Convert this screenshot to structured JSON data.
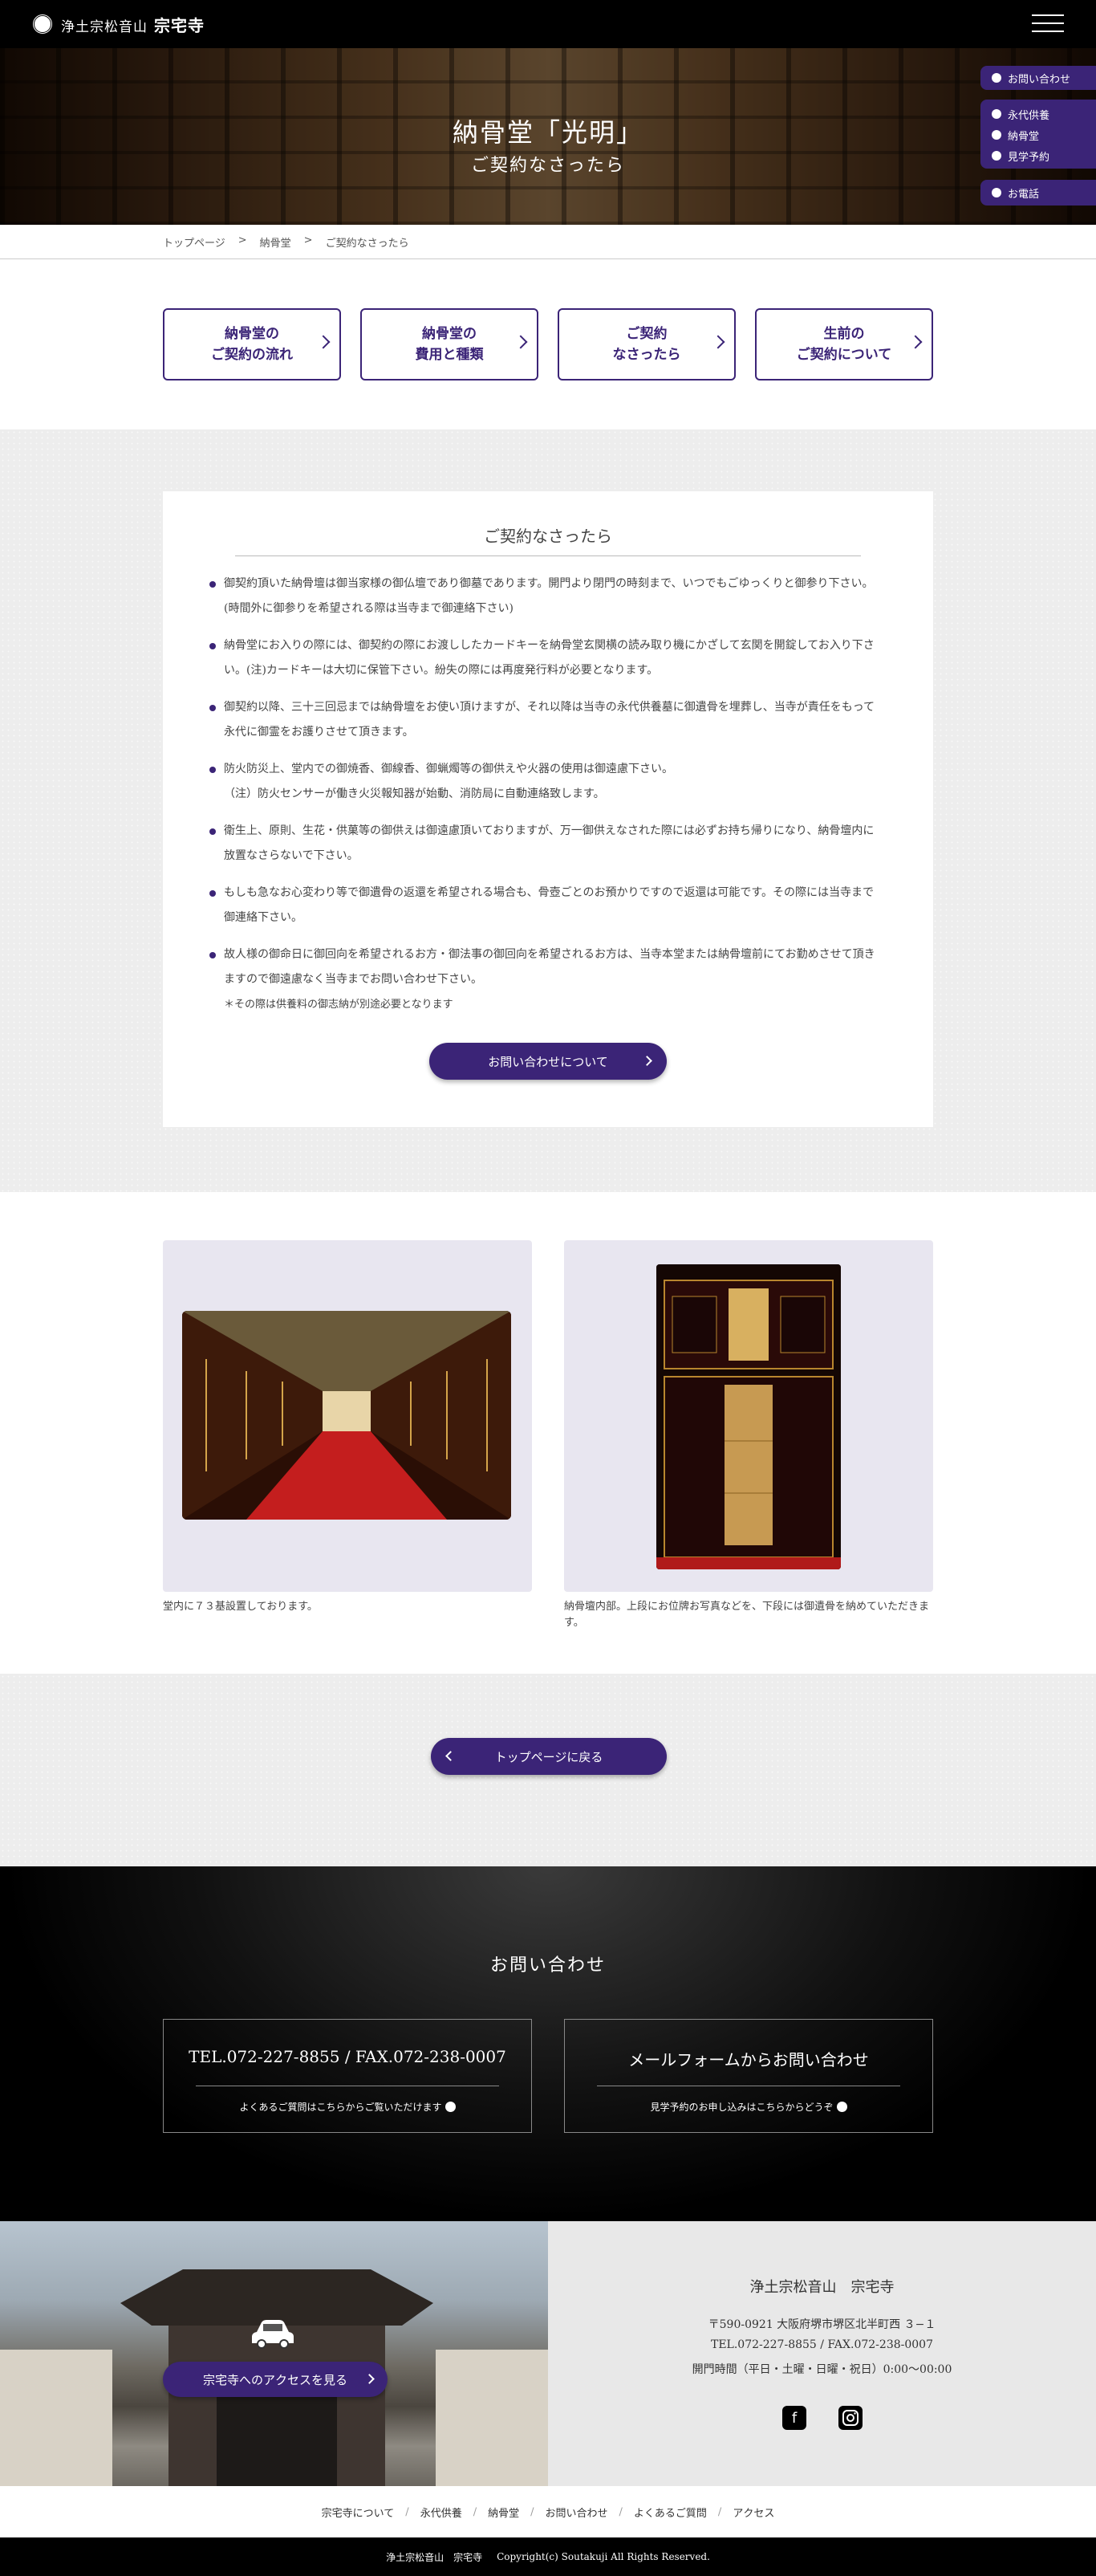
{
  "header": {
    "site_sub": "浄土宗松音山",
    "site_name": "宗宅寺"
  },
  "hero": {
    "title": "納骨堂「光明」",
    "subtitle": "ご契約なさったら"
  },
  "side_menu": {
    "inquiry": "お問い合わせ",
    "eitai": "永代供養",
    "nokotsudo": "納骨堂",
    "kengaku": "見学予約",
    "phone": "お電話"
  },
  "breadcrumb": [
    "トップページ",
    ">",
    "納骨堂",
    ">",
    "ご契約なさったら"
  ],
  "nav_boxes": [
    {
      "line1": "納骨堂の",
      "line2": "ご契約の流れ"
    },
    {
      "line1": "納骨堂の",
      "line2": "費用と種類"
    },
    {
      "line1": "ご契約",
      "line2": "なさったら"
    },
    {
      "line1": "生前の",
      "line2": "ご契約について"
    }
  ],
  "card": {
    "title": "ご契約なさったら",
    "items": [
      {
        "text": "御契約頂いた納骨壇は御当家様の御仏壇であり御墓であります。開門より閉門の時刻まで、いつでもごゆっくりと御参り下さい。(時間外に御参りを希望される際は当寺まで御連絡下さい)",
        "note": ""
      },
      {
        "text": "納骨堂にお入りの際には、御契約の際にお渡ししたカードキーを納骨堂玄関横の読み取り機にかざして玄関を開錠してお入り下さい。(注)カードキーは大切に保管下さい。紛失の際には再度発行料が必要となります。",
        "note": ""
      },
      {
        "text": "御契約以降、三十三回忌までは納骨壇をお使い頂けますが、それ以降は当寺の永代供養墓に御遺骨を埋葬し、当寺が責任をもって永代に御霊をお護りさせて頂きます。",
        "note": ""
      },
      {
        "text": "防火防災上、堂内での御焼香、御線香、御蝋燭等の御供えや火器の使用は御遠慮下さい。",
        "note": "（注）防火センサーが働き火災報知器が始動、消防局に自動連絡致します。"
      },
      {
        "text": "衛生上、原則、生花・供菓等の御供えは御遠慮頂いておりますが、万一御供えなされた際には必ずお持ち帰りになり、納骨壇内に放置なさらないで下さい。",
        "note": ""
      },
      {
        "text": "もしも急なお心変わり等で御遺骨の返還を希望される場合も、骨壺ごとのお預かりですので返還は可能です。その際には当寺まで御連絡下さい。",
        "note": ""
      },
      {
        "text": "故人様の御命日に御回向を希望されるお方・御法事の御回向を希望されるお方は、当寺本堂または納骨壇前にてお勤めさせて頂きますので御遠慮なく当寺までお問い合わせ下さい。",
        "note": "＊その際は供養料の御志納が別途必要となります"
      }
    ],
    "button": "お問い合わせについて"
  },
  "photos": [
    {
      "caption": "堂内に７３基設置しております。"
    },
    {
      "caption": "納骨壇内部。上段にお位牌お写真などを、下段には御遺骨を納めていただきます。"
    }
  ],
  "back_button": "トップページに戻る",
  "contact": {
    "title": "お問い合わせ",
    "tel_box": {
      "main": "TEL.072-227-8855 / FAX.072-238-0007",
      "sub": "よくあるご質問はこちらからご覧いただけます"
    },
    "mail_box": {
      "main": "メールフォームからお問い合わせ",
      "sub": "見学予約のお申し込みはこちらからどうぞ"
    }
  },
  "access": {
    "button": "宗宅寺へのアクセスを見る",
    "temple_sub": "浄土宗松音山",
    "temple_name": "宗宅寺",
    "address": "〒590-0921 大阪府堺市堺区北半町西 ３−１",
    "tel": "TEL.072-227-8855 / FAX.072-238-0007",
    "hours": "開門時間（平日・土曜・日曜・祝日）0:00〜00:00",
    "facebook_icon": "facebook-icon",
    "instagram_icon": "instagram-icon"
  },
  "footer_nav": [
    "宗宅寺について",
    "永代供養",
    "納骨堂",
    "お問い合わせ",
    "よくあるご質問",
    "アクセス"
  ],
  "copyright": {
    "org": "浄土宗松音山　宗宅寺",
    "text": "Copyright(c) Soutakuji All Rights Reserved."
  },
  "colors": {
    "accent": "#3b2477",
    "header_bg": "#000000",
    "section_gray": "#ededed"
  }
}
